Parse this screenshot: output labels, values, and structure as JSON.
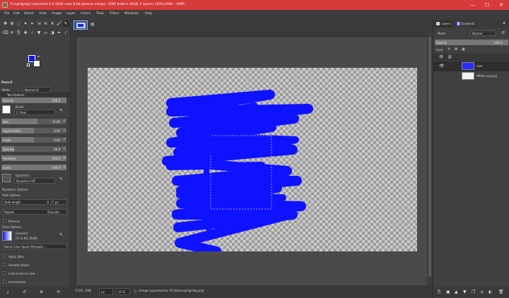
{
  "window": {
    "title": "*[vcgrdgrdg] (exported)-1.0 (RGB color 8-bit gamma integer, GIMP built-in sRGB, 2 layers) 1920x1080 – GIMP",
    "minimize": "—",
    "maximize": "☐",
    "close": "✕"
  },
  "menu": [
    "File",
    "Edit",
    "Select",
    "View",
    "Image",
    "Layer",
    "Colors",
    "Tools",
    "Filters",
    "Windows",
    "Help"
  ],
  "tool_options": {
    "tab_label": "Tool Options",
    "tool_name": "Pencil",
    "mode_label": "Mode",
    "mode_value": "Normal (l)",
    "opacity_label": "Opacity",
    "opacity_value": "100.0",
    "brush_label": "Brush",
    "brush_name": "2. Pixel",
    "size": {
      "label": "Size",
      "value": "35.00",
      "fraction": 0.55
    },
    "aspect_ratio": {
      "label": "Aspect Ratio",
      "value": "0.00",
      "fraction": 0.5
    },
    "angle": {
      "label": "Angle",
      "value": "0.00",
      "fraction": 0.5
    },
    "spacing": {
      "label": "Spacing",
      "value": "20.0",
      "fraction": 0.2
    },
    "hardness": {
      "label": "Hardness",
      "value": "100.0",
      "fraction": 1.0
    },
    "force": {
      "label": "Force",
      "value": "100.0",
      "fraction": 1.0
    },
    "dynamics_label": "Dynamics",
    "dynamics_value": "Dynamics Off",
    "dynamics_options_label": "Dynamics Options",
    "fade_options_label": "Fade Options",
    "fade_length_label": "Fade length",
    "fade_length_value": "0",
    "fade_unit": "px",
    "repeat_label": "Repeat",
    "repeat_value": "Truncate",
    "reverse_label": "Reverse",
    "color_options_label": "Color Options",
    "gradient_label": "Gradient",
    "gradient_name": "FG to BG (RGB)",
    "blend_space": "Blend Color Space Perceptu...",
    "apply_jitter": "Apply Jitter",
    "smooth_stroke": "Smooth stroke",
    "lock_brush": "Lock brush to view",
    "incremental": "Incremental"
  },
  "colors": {
    "foreground": "#1616ff",
    "background": "#ffffff",
    "titlebar": "#d73a3a",
    "stroke": "#0f12ff"
  },
  "icons": {
    "tools": [
      "move-icon",
      "align-icon",
      "free-select-icon",
      "fuzzy-select-icon",
      "crop-icon",
      "unified-transform-icon",
      "warp-icon",
      "text-icon",
      "paintbrush-icon",
      "pencil-icon",
      "eraser-icon",
      "airbrush-icon",
      "clone-icon",
      "heal-icon",
      "smudge-icon",
      "bucket-fill-icon",
      "blend-icon",
      "dodge-icon",
      "path-icon",
      "color-picker-icon"
    ]
  },
  "statusbar": {
    "coords": "1722, 598",
    "unit": "px",
    "zoom": "33 %",
    "message": "Image exported to 'D:\\Art\\vcgrdgrdg.png'"
  },
  "dock": {
    "tab_layers": "Layers",
    "tab_gradients": "Gradients",
    "mode_label": "Mode",
    "mode_value": "Normal",
    "opacity_label": "Opacity",
    "opacity_value": "100.0",
    "lock_label": "Lock:",
    "layers": [
      {
        "name": "new",
        "selected": true
      },
      {
        "name": "White.svg.png",
        "selected": false
      }
    ]
  }
}
